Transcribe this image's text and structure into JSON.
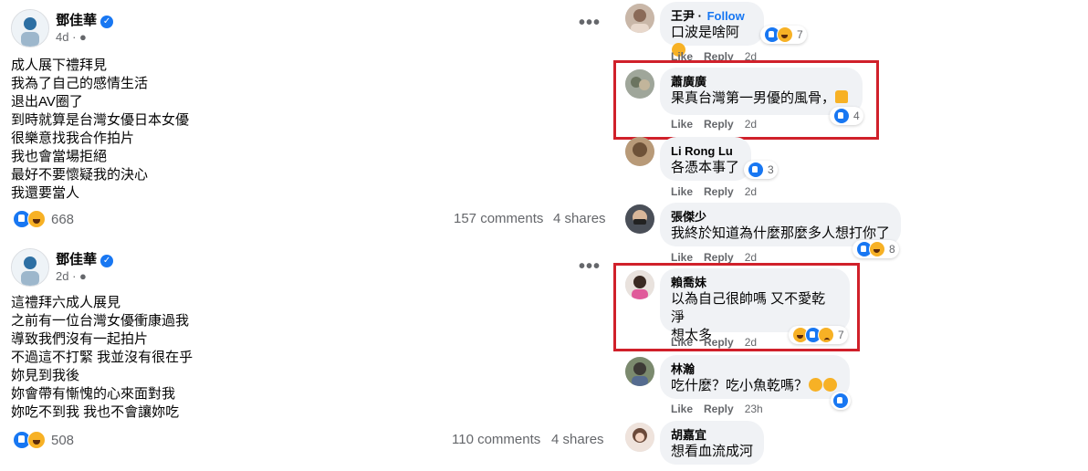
{
  "posts": [
    {
      "author": "鄧佳華",
      "time": "4d",
      "lines": [
        "成人展下禮拜見",
        "我為了自己的感情生活",
        "退出AV圈了",
        "到時就算是台灣女優日本女優",
        "很樂意找我合作拍片",
        "我也會當場拒絕",
        "最好不要懷疑我的決心",
        "我還要當人"
      ],
      "reactions_count": "668",
      "comments": "157 comments",
      "shares": "4 shares"
    },
    {
      "author": "鄧佳華",
      "time": "2d",
      "lines": [
        "這禮拜六成人展見",
        "之前有一位台灣女優衝康過我",
        "導致我們沒有一起拍片",
        "不過這不打緊 我並沒有很在乎",
        "妳見到我後",
        "妳會帶有慚愧的心來面對我",
        "妳吃不到我 我也不會讓妳吃"
      ],
      "reactions_count": "508",
      "comments": "110 comments",
      "shares": "4 shares"
    }
  ],
  "comments": [
    {
      "name": "王尹",
      "follow": "Follow",
      "text": "口波是啥阿",
      "reactions": "7",
      "like": "Like",
      "reply": "Reply",
      "time": "2d"
    },
    {
      "name": "蕭廣廣",
      "text": "果真台灣第一男優的風骨，",
      "reactions": "4",
      "like": "Like",
      "reply": "Reply",
      "time": "2d"
    },
    {
      "name": "Li Rong Lu",
      "text": "各憑本事了",
      "reactions": "3",
      "like": "Like",
      "reply": "Reply",
      "time": "2d"
    },
    {
      "name": "張傑少",
      "text": "我終於知道為什麼那麼多人想打你了",
      "reactions": "8",
      "like": "Like",
      "reply": "Reply",
      "time": "2d"
    },
    {
      "name": "賴喬妹",
      "text1": "以為自己很帥嗎 又不愛乾淨",
      "text2": "想太多",
      "reactions": "7",
      "like": "Like",
      "reply": "Reply",
      "time": "2d"
    },
    {
      "name": "林瀚",
      "text": "吃什麼？吃小魚乾嗎？",
      "like": "Like",
      "reply": "Reply",
      "time": "23h"
    },
    {
      "name": "胡嘉宜",
      "text": "想看血流成河"
    }
  ],
  "colors": {
    "accent": "#1877f2",
    "highlight": "#d0202a",
    "bubble": "#f0f2f5",
    "muted": "#65676b"
  }
}
